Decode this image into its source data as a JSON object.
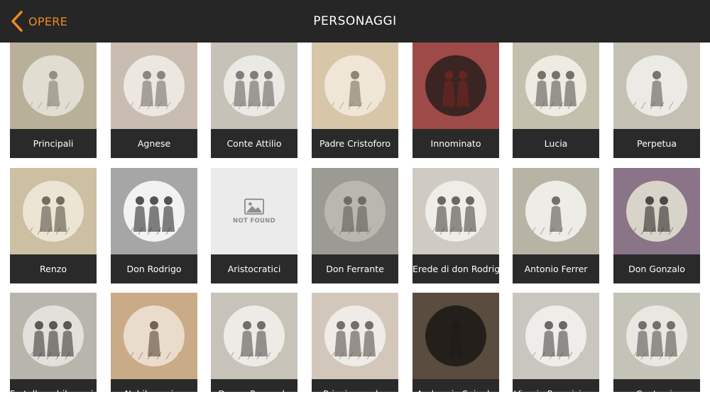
{
  "header": {
    "back_label": "OPERE",
    "title": "PERSONAGGI",
    "accent_color": "#f08a24",
    "bar_color": "#262626"
  },
  "not_found_text": "NOT FOUND",
  "rows": [
    [
      {
        "label": "Principali",
        "bg": "#b9b09a",
        "tone": "#7a7566",
        "circle": "#e2ddd1",
        "icon": "engraving-couple"
      },
      {
        "label": "Agnese",
        "bg": "#c9bdb2",
        "tone": "#6d665f",
        "circle": "#ece7e1",
        "icon": "engraving-woman"
      },
      {
        "label": "Conte Attilio",
        "bg": "#c7c2b8",
        "tone": "#5c5954",
        "circle": "#ebe9e5",
        "icon": "engraving-nobleman"
      },
      {
        "label": "Padre Cristoforo",
        "bg": "#d8c6a8",
        "tone": "#6f6657",
        "circle": "#efe6d6",
        "icon": "engraving-friar"
      },
      {
        "label": "Innominato",
        "bg": "#9e4a48",
        "tone": "#7a2622",
        "circle": "#3a2522",
        "icon": "portrait-red-robe"
      },
      {
        "label": "Lucia",
        "bg": "#c3c0ad",
        "tone": "#4d4a42",
        "circle": "#eeebe3",
        "icon": "engraving-young-woman"
      },
      {
        "label": "Perpetua",
        "bg": "#c4c0b4",
        "tone": "#4f4c46",
        "circle": "#eceae4",
        "icon": "engraving-kitchen"
      }
    ],
    [
      {
        "label": "Renzo",
        "bg": "#cdc0a2",
        "tone": "#4a443a",
        "circle": "#ede5d3",
        "icon": "engraving-young-man-hat"
      },
      {
        "label": "Don Rodrigo",
        "bg": "#a6a6a6",
        "tone": "#1d1d1d",
        "circle": "#f2f2f2",
        "icon": "engraving-cavalier"
      },
      {
        "label": "Aristocratici",
        "bg": "#ebebeb",
        "tone": "#8e8e8e",
        "circle": "none",
        "icon": "image-placeholder-icon"
      },
      {
        "label": "Don Ferrante",
        "bg": "#9b9b94",
        "tone": "#55554f",
        "circle": "#b8b8b1",
        "icon": "engraving-study"
      },
      {
        "label": "Erede di don Rodrigo",
        "bg": "#cfcbc2",
        "tone": "#3d3b37",
        "circle": "#efede8",
        "icon": "engraving-two-men"
      },
      {
        "label": "Antonio Ferrer",
        "bg": "#b7b3a5",
        "tone": "#4a4843",
        "circle": "#eeece7",
        "icon": "engraving-carriage"
      },
      {
        "label": "Don Gonzalo",
        "bg": "#8a7488",
        "tone": "#1f1b1d",
        "circle": "#d9d4c9",
        "icon": "engraving-armored-man"
      }
    ],
    [
      {
        "label": "Fratello nobile ucciso",
        "bg": "#b8b5ad",
        "tone": "#2e2c29",
        "circle": "#e2e0da",
        "icon": "engraving-crowd"
      },
      {
        "label": "Nobile ucciso",
        "bg": "#c9ab88",
        "tone": "#4d3a2a",
        "circle": "#eadccb",
        "icon": "engraving-duel"
      },
      {
        "label": "Donna Prassede",
        "bg": "#c8c3b8",
        "tone": "#494640",
        "circle": "#ecebe6",
        "icon": "engraving-room"
      },
      {
        "label": "Principe padre",
        "bg": "#d3c7bb",
        "tone": "#4c463f",
        "circle": "#efebe6",
        "icon": "engraving-father-child"
      },
      {
        "label": "Ambrogio Spinola",
        "bg": "#5a4c3e",
        "tone": "#1d1a17",
        "circle": "#241f1b",
        "icon": "portrait-armor"
      },
      {
        "label": "Vicario Provvisione",
        "bg": "#c9c6c0",
        "tone": "#3e3c39",
        "circle": "#eeede9",
        "icon": "engraving-seated-man"
      },
      {
        "label": "Conte zio",
        "bg": "#c4c3b7",
        "tone": "#4a4944",
        "circle": "#e8e7e1",
        "icon": "engraving-meeting"
      }
    ]
  ]
}
